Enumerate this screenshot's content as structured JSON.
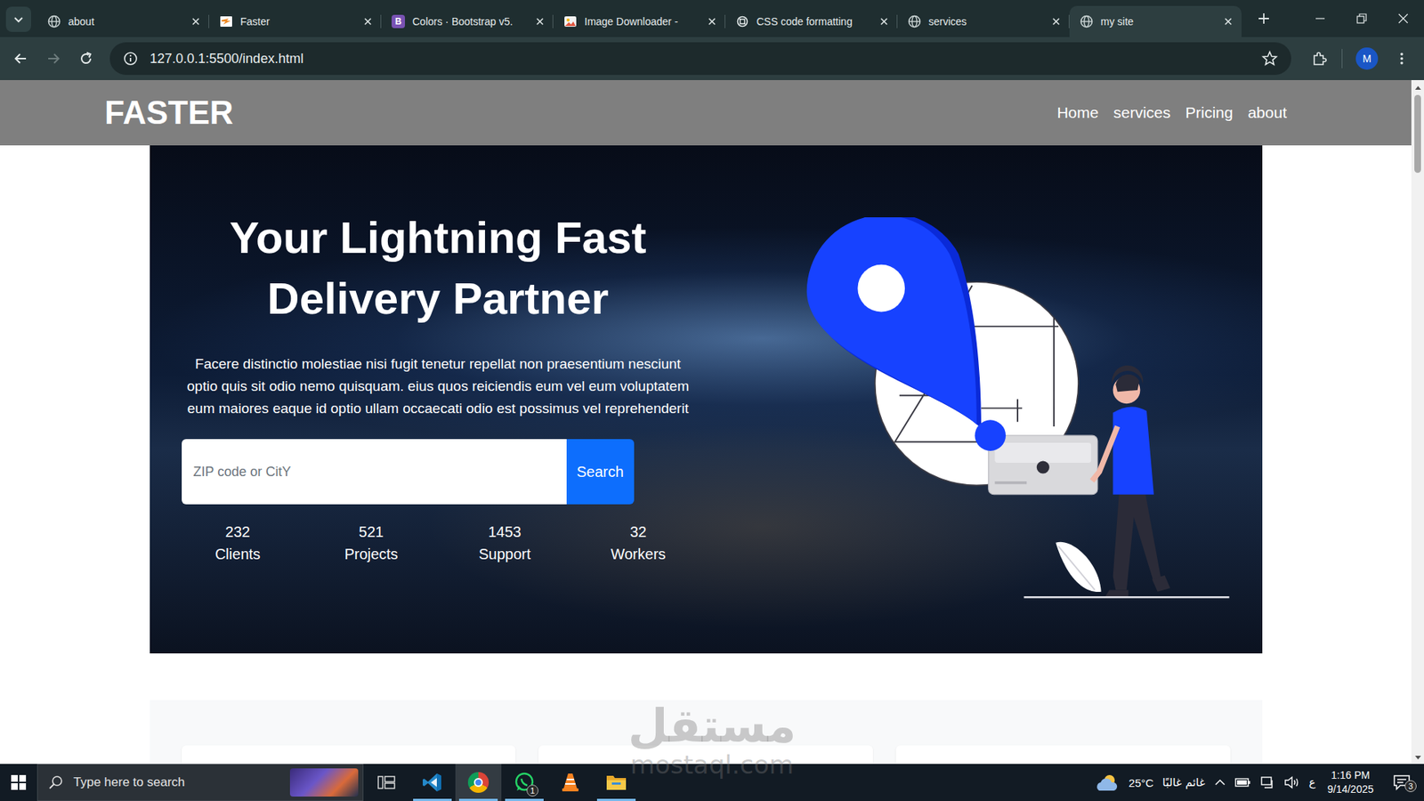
{
  "browser": {
    "tabs": [
      {
        "label": "about",
        "kind": "globe",
        "icon_letter": "",
        "selected": false
      },
      {
        "label": "Faster",
        "kind": "faster",
        "icon_letter": "",
        "selected": false
      },
      {
        "label": "Colors · Bootstrap v5.",
        "kind": "bootstrap",
        "icon_letter": "B",
        "selected": false
      },
      {
        "label": "Image Downloader -",
        "kind": "image",
        "icon_letter": "",
        "selected": false
      },
      {
        "label": "CSS code formatting",
        "kind": "openai",
        "icon_letter": "",
        "selected": false
      },
      {
        "label": "services",
        "kind": "globe",
        "icon_letter": "",
        "selected": false
      },
      {
        "label": "my site",
        "kind": "globe",
        "icon_letter": "",
        "selected": true
      }
    ],
    "back_disabled": false,
    "forward_disabled": true,
    "url": "127.0.0.1:5500/index.html",
    "profile": "M"
  },
  "page": {
    "brand": "FASTER",
    "nav": [
      "Home",
      "services",
      "Pricing",
      "about"
    ],
    "hero": {
      "title": "Your Lightning Fast Delivery Partner",
      "text": "Facere distinctio molestiae nisi fugit tenetur repellat non praesentium nesciunt optio quis sit odio nemo quisquam. eius quos reiciendis eum vel eum voluptatem eum maiores eaque id optio ullam occaecati odio est possimus vel reprehenderit",
      "search": {
        "placeholder": "ZIP code or CitY",
        "button": "Search"
      },
      "stats": [
        {
          "value": "232",
          "label": "Clients"
        },
        {
          "value": "521",
          "label": "Projects"
        },
        {
          "value": "1453",
          "label": "Support"
        },
        {
          "value": "32",
          "label": "Workers"
        }
      ]
    },
    "cards": [
      {},
      {},
      {}
    ]
  },
  "watermark": {
    "arabic": "مستقل",
    "latin": "mostaql.com"
  },
  "taskbar": {
    "search_placeholder": "Type here to search",
    "apps": [
      {
        "kind": "task-view",
        "open": false,
        "selected": false,
        "badge": ""
      },
      {
        "kind": "vscode",
        "open": true,
        "selected": false,
        "badge": ""
      },
      {
        "kind": "chrome",
        "open": true,
        "selected": true,
        "badge": ""
      },
      {
        "kind": "whatsapp",
        "open": true,
        "selected": false,
        "badge": "1"
      },
      {
        "kind": "vlc",
        "open": false,
        "selected": false,
        "badge": ""
      },
      {
        "kind": "explorer",
        "open": true,
        "selected": false,
        "badge": ""
      }
    ],
    "weather": {
      "temp": "25°C",
      "condition": "غائم غالبًا"
    },
    "language": "ع",
    "time": "1:16 PM",
    "date": "9/14/2025",
    "notifications": "3"
  }
}
